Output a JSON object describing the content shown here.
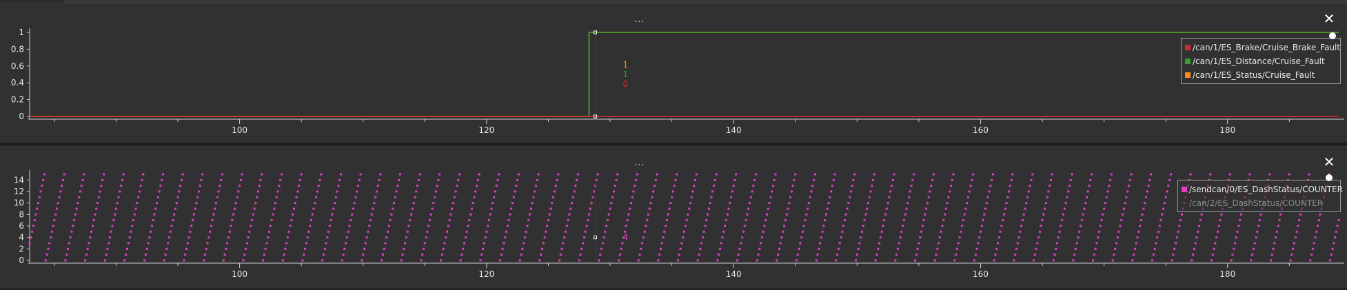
{
  "colors": {
    "brake_fault": "#d42c2c",
    "distance_fault": "#33a02c",
    "status_fault": "#ff8c1a",
    "counter": "#e040c8",
    "cursor": "#cc0000",
    "axis": "#d0d0d0"
  },
  "panels": [
    {
      "menu_label": "...",
      "close_label": "✕"
    },
    {
      "menu_label": "...",
      "close_label": "✕"
    }
  ],
  "chart_data": [
    {
      "type": "line",
      "x_ticks": [
        100,
        120,
        140,
        160,
        180
      ],
      "y_ticks": [
        "1",
        "0.8",
        "0.6",
        "0.4",
        "0.2",
        "0"
      ],
      "xlim": [
        83,
        189
      ],
      "ylim": [
        0,
        1
      ],
      "grid": false,
      "legend_position": "top-right",
      "cursor": {
        "x": 128.8,
        "values": [
          "1",
          "1",
          "0"
        ]
      },
      "series": [
        {
          "name": "/can/1/ES_Brake/Cruise_Brake_Fault",
          "color_key": "brake_fault",
          "visible": true,
          "points": [
            [
              83,
              0
            ],
            [
              189,
              0
            ]
          ]
        },
        {
          "name": "/can/1/ES_Distance/Cruise_Fault",
          "color_key": "distance_fault",
          "visible": true,
          "points": [
            [
              83,
              0
            ],
            [
              128.3,
              0
            ],
            [
              128.3,
              1
            ],
            [
              189,
              1
            ]
          ]
        },
        {
          "name": "/can/1/ES_Status/Cruise_Fault",
          "color_key": "status_fault",
          "visible": true,
          "points": [
            [
              83,
              0
            ],
            [
              128.3,
              0
            ],
            [
              128.3,
              1
            ],
            [
              189,
              1
            ]
          ]
        }
      ]
    },
    {
      "type": "scatter",
      "x_ticks": [
        100,
        120,
        140,
        160,
        180
      ],
      "y_ticks": [
        "14",
        "12",
        "10",
        "8",
        "6",
        "4",
        "2",
        "0"
      ],
      "xlim": [
        83,
        189
      ],
      "ylim": [
        0,
        15
      ],
      "grid": false,
      "legend_position": "top-right",
      "cursor": {
        "x": 128.8,
        "values": [
          "4"
        ]
      },
      "series": [
        {
          "name": "/sendcan/0/ES_DashStatus/COUNTER",
          "color_key": "counter",
          "visible": true,
          "pattern": {
            "kind": "sawtooth",
            "x_start": 82.7,
            "x_end": 189,
            "period": 1.6,
            "min": 0,
            "max": 15
          }
        },
        {
          "name": "/can/2/ES_DashStatus/COUNTER",
          "color_key": "counter",
          "visible": false
        }
      ]
    }
  ]
}
